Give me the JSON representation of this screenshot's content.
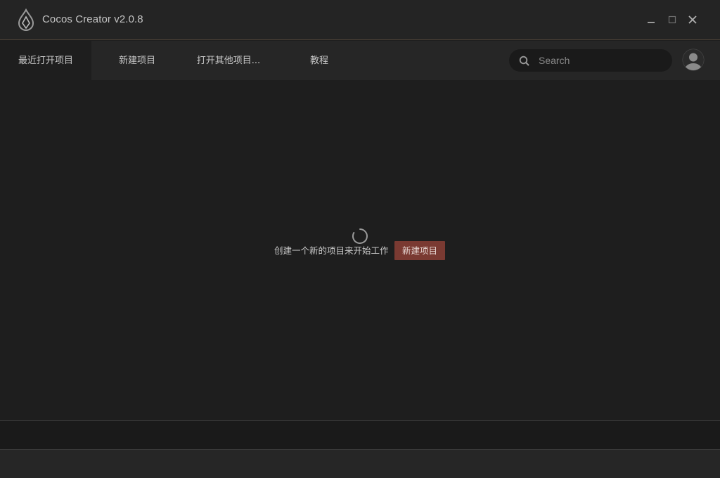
{
  "window": {
    "title": "Cocos Creator v2.0.8"
  },
  "icons": {
    "logo": "cocos-logo-icon",
    "minimize": "minimize-icon",
    "maximize": "maximize-icon",
    "close": "close-icon",
    "search": "search-icon",
    "avatar": "user-avatar-icon",
    "loading": "loading-spinner-icon"
  },
  "nav": {
    "tabs": [
      {
        "label": "最近打开项目",
        "active": true
      },
      {
        "label": "新建项目",
        "active": false
      },
      {
        "label": "打开其他项目...",
        "active": false
      },
      {
        "label": "教程",
        "active": false
      }
    ]
  },
  "search": {
    "placeholder": "Search",
    "value": ""
  },
  "main": {
    "empty_message": "创建一个新的项目来开始工作",
    "create_button_label": "新建项目"
  },
  "colors": {
    "accent": "#7a3a32",
    "background": "#1e1e1e",
    "titlebar": "#242424",
    "divider": "#4a3f35"
  }
}
